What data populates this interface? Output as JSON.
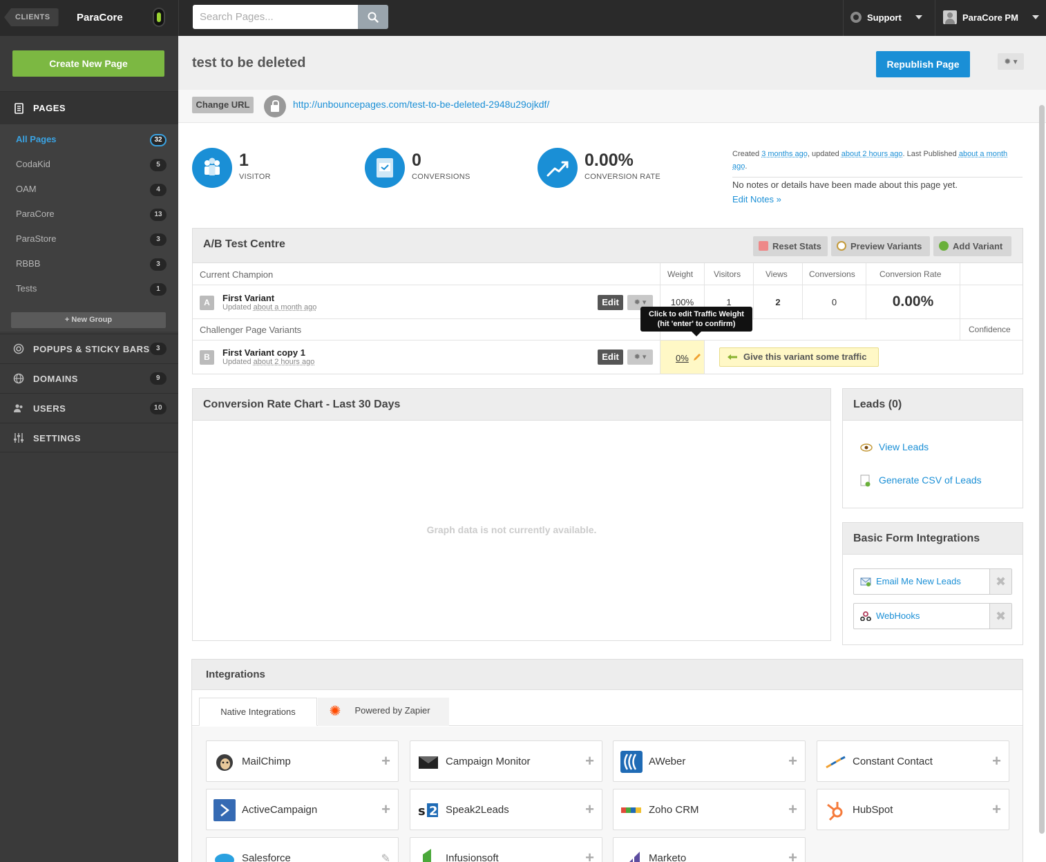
{
  "topbar": {
    "clients_label": "CLIENTS",
    "client_name": "ParaCore",
    "search_placeholder": "Search Pages...",
    "support_label": "Support",
    "user_label": "ParaCore PM"
  },
  "sidebar": {
    "create_label": "Create New Page",
    "pages_label": "PAGES",
    "page_groups": [
      {
        "name": "All Pages",
        "count": "32"
      },
      {
        "name": "CodaKid",
        "count": "5"
      },
      {
        "name": "OAM",
        "count": "4"
      },
      {
        "name": "ParaCore",
        "count": "13"
      },
      {
        "name": "ParaStore",
        "count": "3"
      },
      {
        "name": "RBBB",
        "count": "3"
      },
      {
        "name": "Tests",
        "count": "1"
      }
    ],
    "new_group_label": "+ New Group",
    "sections": [
      {
        "label": "POPUPS & STICKY BARS",
        "count": "3"
      },
      {
        "label": "DOMAINS",
        "count": "9"
      },
      {
        "label": "USERS",
        "count": "10"
      },
      {
        "label": "SETTINGS",
        "count": ""
      }
    ]
  },
  "header": {
    "title": "test to be deleted",
    "republish_label": "Republish Page",
    "change_url_label": "Change URL",
    "url": "http://unbouncepages.com/test-to-be-deleted-2948u29ojkdf/"
  },
  "stats": [
    {
      "value": "1",
      "label": "VISITOR"
    },
    {
      "value": "0",
      "label": "CONVERSIONS"
    },
    {
      "value": "0.00%",
      "label": "CONVERSION RATE"
    }
  ],
  "meta": {
    "created_prefix": "Created ",
    "created_ago": "3 months ago",
    "updated_prefix": ", updated ",
    "updated_ago": "about 2 hours ago",
    "published_prefix": ". Last Published ",
    "published_ago": "about a month ago",
    "period": ".",
    "notes_text": "No notes or details have been made about this page yet.",
    "edit_notes_label": "Edit Notes »"
  },
  "ab": {
    "title": "A/B Test Centre",
    "reset_label": "Reset Stats",
    "preview_label": "Preview Variants",
    "add_label": "Add Variant",
    "champion_label": "Current Champion",
    "challenger_label": "Challenger Page Variants",
    "columns": {
      "weight": "Weight",
      "visitors": "Visitors",
      "views": "Views",
      "conversions": "Conversions",
      "rate": "Conversion Rate",
      "confidence": "Confidence"
    },
    "edit_label": "Edit",
    "updated_prefix": "Updated ",
    "champion": {
      "badge": "A",
      "name": "First Variant",
      "updated": "about a month ago",
      "weight": "100%",
      "visitors": "1",
      "views": "2",
      "conversions": "0",
      "rate": "0.00%"
    },
    "challenger": {
      "badge": "B",
      "name": "First Variant copy 1",
      "updated": "about 2 hours ago",
      "weight": "0%",
      "traffic_label": "Give this variant some traffic"
    },
    "tooltip_line1": "Click to edit Traffic Weight",
    "tooltip_line2": "(hit 'enter' to confirm)"
  },
  "chart": {
    "title": "Conversion Rate Chart - Last 30 Days",
    "empty_text": "Graph data is not currently available."
  },
  "leads": {
    "title": "Leads (0)",
    "view_label": "View Leads",
    "csv_label": "Generate CSV of Leads"
  },
  "forms": {
    "title": "Basic Form Integrations",
    "items": [
      "Email Me New Leads",
      "WebHooks"
    ]
  },
  "integrations": {
    "title": "Integrations",
    "tab_native": "Native Integrations",
    "tab_zapier": "Powered by Zapier",
    "items": [
      "MailChimp",
      "Campaign Monitor",
      "AWeber",
      "Constant Contact",
      "ActiveCampaign",
      "Speak2Leads",
      "Zoho CRM",
      "HubSpot",
      "Salesforce",
      "Infusionsoft",
      "Marketo"
    ]
  },
  "colors": {
    "accent": "#1a8fd6",
    "create": "#7cb842",
    "sidebar": "#3a3a3a",
    "topbar": "#2a2a2a"
  }
}
